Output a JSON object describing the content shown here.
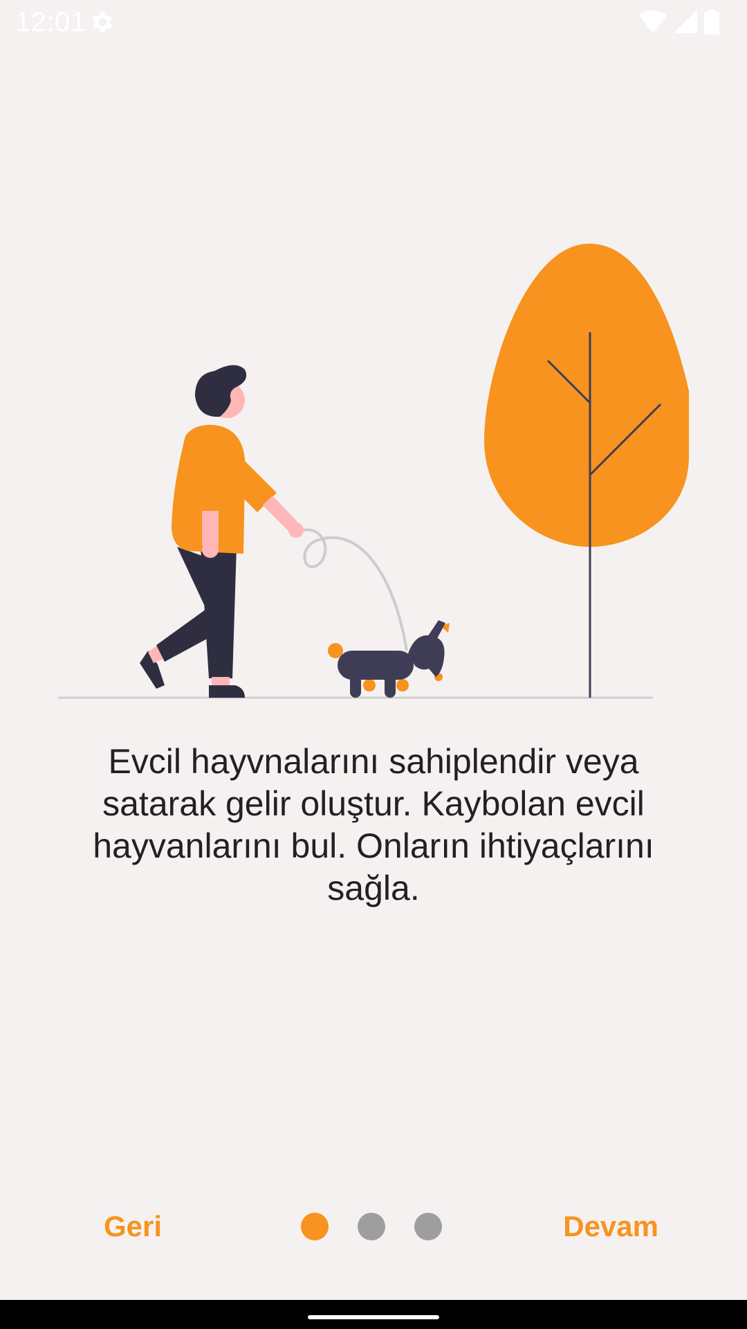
{
  "status_bar": {
    "time": "12:01",
    "icons": [
      "settings-gear-icon",
      "wifi-icon",
      "cellular-signal-icon",
      "battery-icon"
    ]
  },
  "onboarding": {
    "description": "Evcil hayvnalarını sahiplendir veya satarak gelir oluştur. Kaybolan evcil hayvanlarını bul. Onların ihtiyaçlarını sağla.",
    "illustration": "person-walking-dog-illustration",
    "page_indicator": {
      "total": 3,
      "current": 1
    }
  },
  "navigation": {
    "back_label": "Geri",
    "next_label": "Devam"
  },
  "colors": {
    "accent": "#F7931E",
    "background": "#F5F1F0",
    "text": "#212121",
    "inactive_dot": "#9E9E9E",
    "dark_figure": "#2F2E41"
  }
}
